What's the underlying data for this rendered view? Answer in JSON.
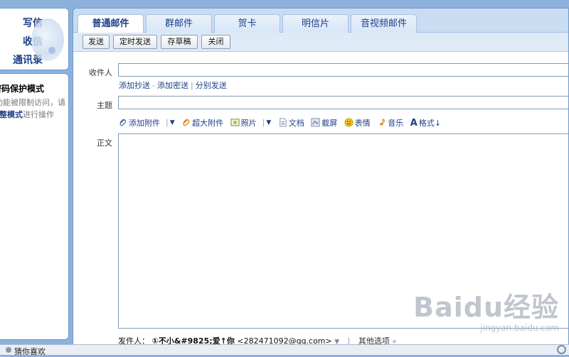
{
  "sidebar": {
    "nav": [
      "写信",
      "收信",
      "通讯录"
    ],
    "notice": {
      "title": "密码保护模式",
      "line1": "部分功能被限制访问，请",
      "line2_bold": "完整模式",
      "line2_rest": "进行操作"
    }
  },
  "tabs": [
    {
      "label": "普通邮件",
      "active": true
    },
    {
      "label": "群邮件"
    },
    {
      "label": "贺卡"
    },
    {
      "label": "明信片"
    },
    {
      "label": "音视频邮件"
    }
  ],
  "toolbar": {
    "send": "发送",
    "scheduled_send": "定时发送",
    "save_draft": "存草稿",
    "close": "关闭"
  },
  "compose": {
    "recipient_label": "收件人",
    "recipient_value": "",
    "cc_links": {
      "add_cc": "添加抄送",
      "add_bcc": "添加密送",
      "separate": "分别发送",
      "dash": "-",
      "bar": "|"
    },
    "subject_label": "主题",
    "subject_value": "",
    "body_label": "正文",
    "body_value": "",
    "attach_bar": {
      "attachment": "添加附件",
      "large_attachment": "超大附件",
      "photo": "照片",
      "document": "文档",
      "screenshot": "截屏",
      "emoticon": "表情",
      "music": "音乐",
      "format": "格式↓"
    },
    "sender": {
      "label": "发件人：",
      "name": "①不小&#9825;爱↑你",
      "email": "<282471092@qq.com>",
      "more_options": "其他选项"
    }
  },
  "statusbar": {
    "text": "猜你喜欢"
  },
  "watermark": {
    "brand": "Baidu经验",
    "domain": "jingyan.baidu.com"
  },
  "colors": {
    "accent": "#1c3f86",
    "frame": "#8cb2dc"
  }
}
